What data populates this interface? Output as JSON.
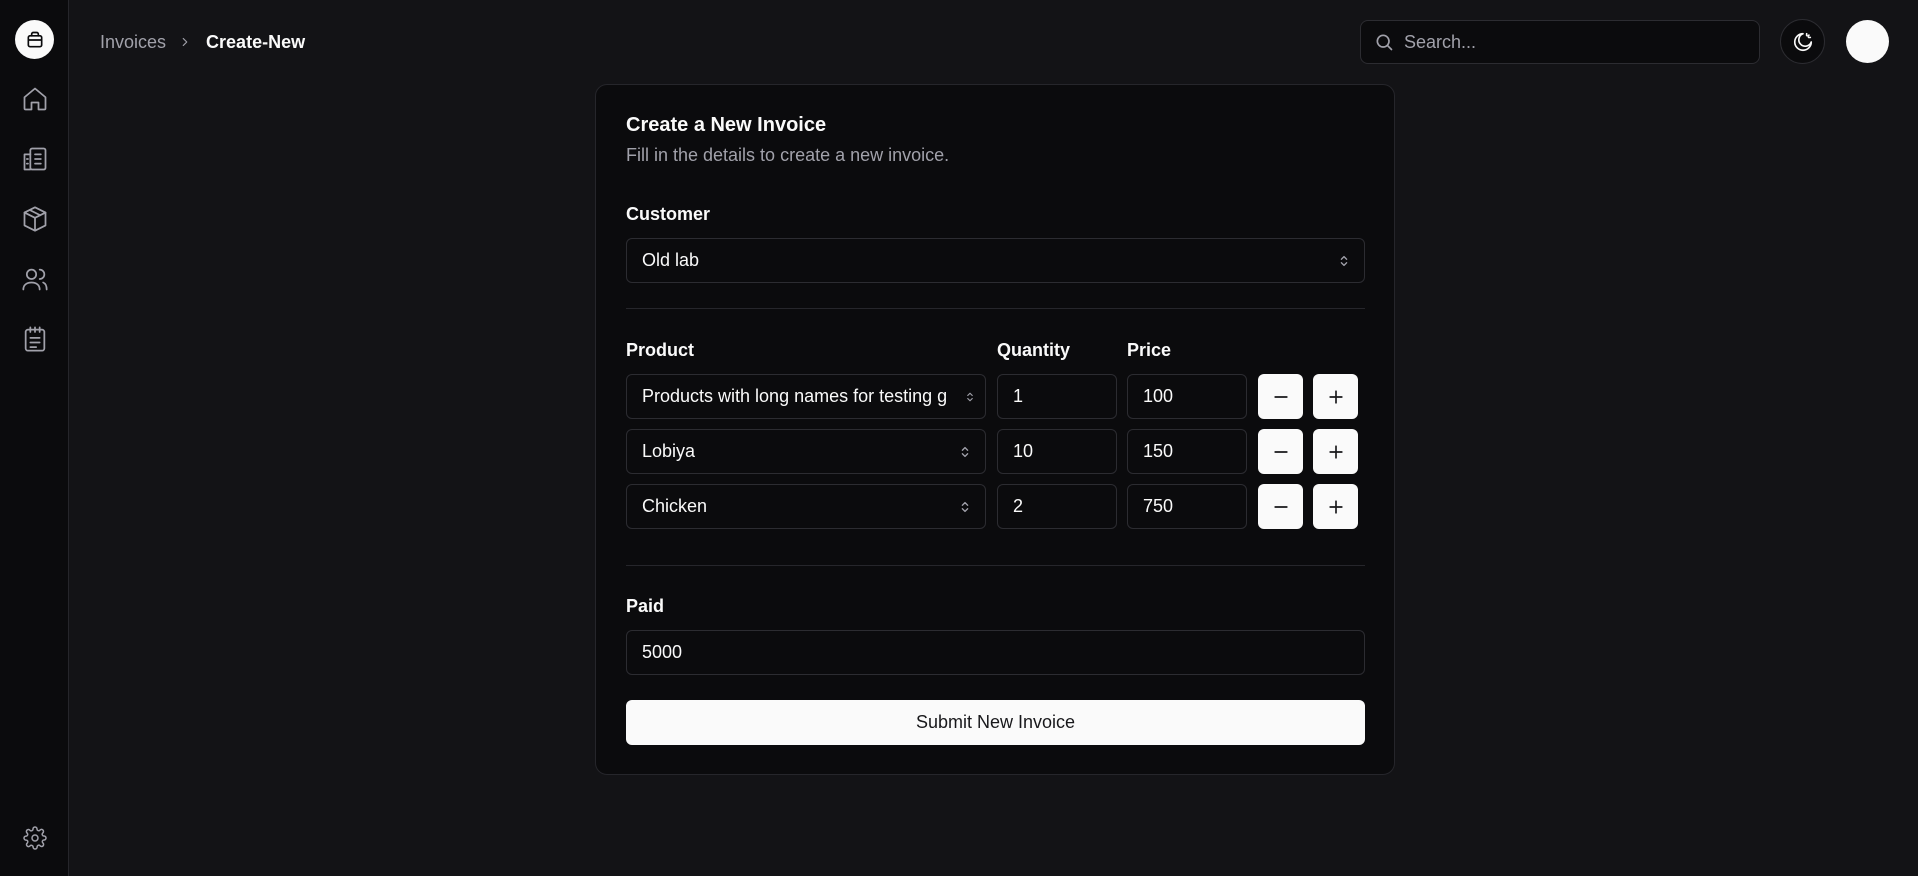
{
  "breadcrumb": {
    "parent": "Invoices",
    "current": "Create-New"
  },
  "search": {
    "placeholder": "Search..."
  },
  "sidebar": {
    "items": [
      {
        "icon": "home-icon"
      },
      {
        "icon": "invoices-icon"
      },
      {
        "icon": "products-box-icon"
      },
      {
        "icon": "customers-users-icon"
      },
      {
        "icon": "clipboard-icon"
      }
    ],
    "footer_icon": "settings-gear-icon"
  },
  "form": {
    "title": "Create a New Invoice",
    "subtitle": "Fill in the details to create a new invoice.",
    "customer_label": "Customer",
    "customer_value": "Old lab",
    "product_label": "Product",
    "quantity_label": "Quantity",
    "price_label": "Price",
    "lines": [
      {
        "product": "Products with long names for testing g",
        "quantity": "1",
        "price": "100"
      },
      {
        "product": "Lobiya",
        "quantity": "10",
        "price": "150"
      },
      {
        "product": "Chicken",
        "quantity": "2",
        "price": "750"
      }
    ],
    "paid_label": "Paid",
    "paid_value": "5000",
    "submit_label": "Submit New Invoice"
  },
  "colors": {
    "background": "#131316",
    "surface": "#0b0b0d",
    "border": "#26262b",
    "accent": "#fafafa"
  }
}
